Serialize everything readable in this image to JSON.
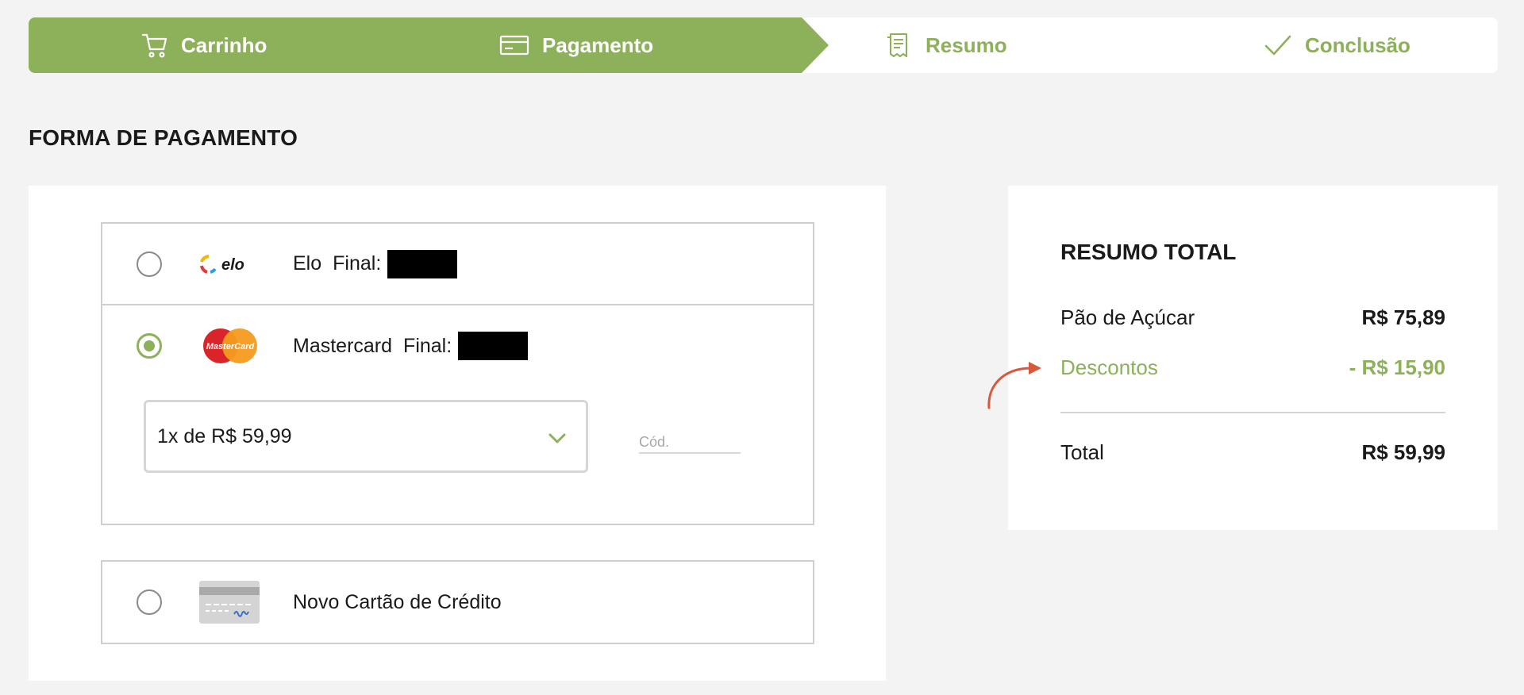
{
  "stepper": {
    "steps": [
      {
        "label": "Carrinho",
        "icon": "cart-icon",
        "state": "done"
      },
      {
        "label": "Pagamento",
        "icon": "credit-card-icon",
        "state": "current"
      },
      {
        "label": "Resumo",
        "icon": "receipt-icon",
        "state": "todo"
      },
      {
        "label": "Conclusão",
        "icon": "check-icon",
        "state": "todo"
      }
    ],
    "accent_color": "#8db05a"
  },
  "payment": {
    "section_title": "FORMA DE PAGAMENTO",
    "cards": [
      {
        "brand": "Elo",
        "logo": "elo-logo",
        "final_label": "Final:",
        "selected": false
      },
      {
        "brand": "Mastercard",
        "logo": "mastercard-logo",
        "final_label": "Final:",
        "selected": true
      }
    ],
    "installments_value": "1x de R$ 59,99",
    "cvv_placeholder": "Cód.",
    "new_card_label": "Novo Cartão de Crédito",
    "new_card_icon": "generic-card-icon"
  },
  "summary": {
    "title": "RESUMO TOTAL",
    "rows": [
      {
        "label": "Pão de Açúcar",
        "amount": "R$ 75,89"
      },
      {
        "label": "Descontos",
        "amount": "- R$ 15,90"
      }
    ],
    "total_label": "Total",
    "total_amount": "R$ 59,99",
    "discount_color": "#8db05a",
    "annotation_arrow_color": "#d9573a"
  }
}
